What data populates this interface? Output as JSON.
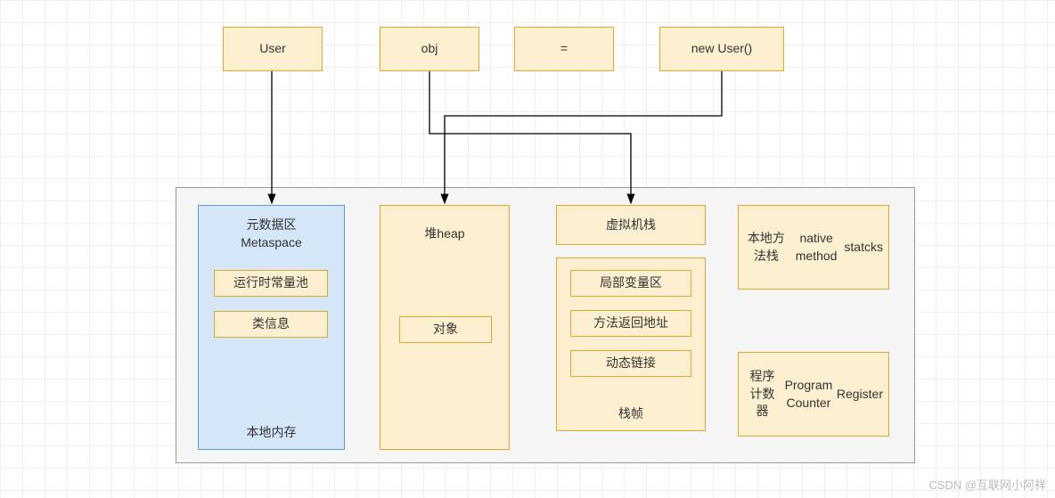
{
  "top": {
    "user": "User",
    "obj": "obj",
    "equals": "=",
    "newUser": "new User()"
  },
  "metaspace": {
    "title1": "元数据区",
    "title2": "Metaspace",
    "constPool": "运行时常量池",
    "classInfo": "类信息",
    "bottom": "本地内存"
  },
  "heap": {
    "title": "堆heap",
    "object": "对象"
  },
  "vmstack": {
    "title": "虚拟机栈",
    "frame": {
      "local": "局部变量区",
      "retAddr": "方法返回地址",
      "dynLink": "动态链接",
      "bottom": "栈帧"
    }
  },
  "native": {
    "line1": "本地方法栈",
    "line2": "native method",
    "line3": "statcks"
  },
  "pc": {
    "line1": "程序计数器",
    "line2": "Program Counter",
    "line3": "Register"
  },
  "watermark": "CSDN @互联网小阿祥"
}
